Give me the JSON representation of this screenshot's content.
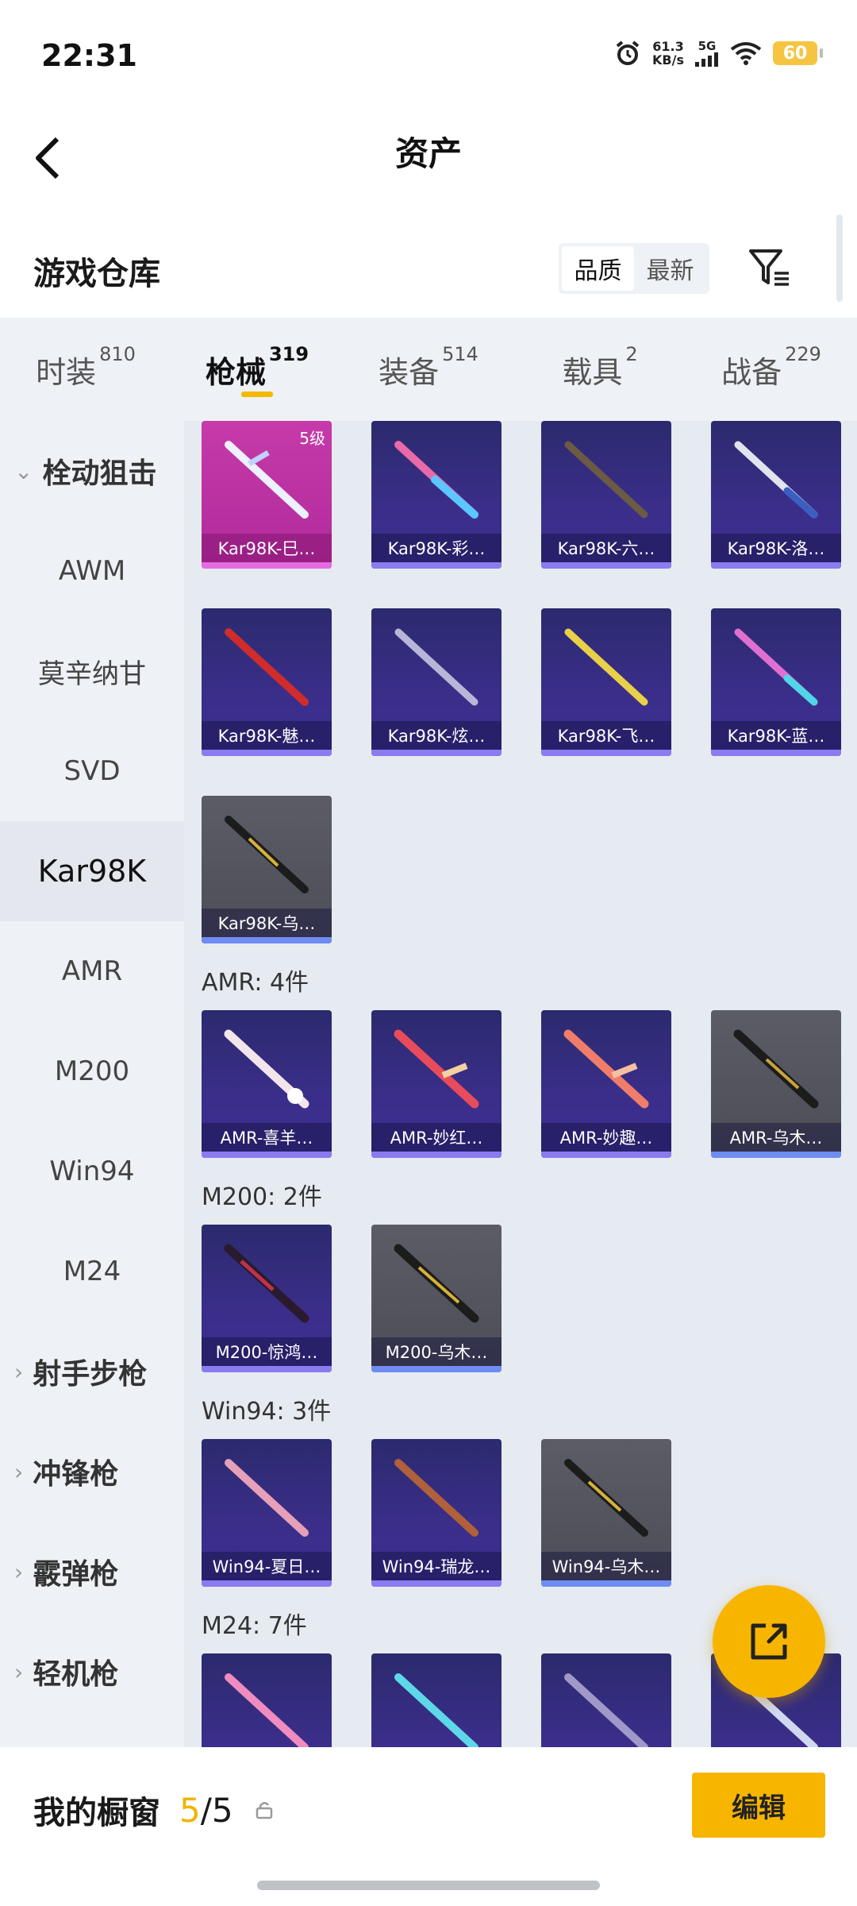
{
  "status_bar": {
    "time": "22:31",
    "net_speed": "61.3",
    "net_unit": "KB/s",
    "network": "5G",
    "battery": "60"
  },
  "header": {
    "title": "资产"
  },
  "warehouse": {
    "title": "游戏仓库",
    "sort_options": [
      "品质",
      "最新"
    ]
  },
  "tabs": [
    {
      "label": "时装",
      "count": "810"
    },
    {
      "label": "枪械",
      "count": "319"
    },
    {
      "label": "装备",
      "count": "514"
    },
    {
      "label": "载具",
      "count": "2"
    },
    {
      "label": "战备",
      "count": "229"
    }
  ],
  "sidebar": {
    "items": [
      "栓动狙击",
      "AWM",
      "莫辛纳甘",
      "SVD",
      "Kar98K",
      "AMR",
      "M200",
      "Win94",
      "M24",
      "射手步枪",
      "冲锋枪",
      "霰弹枪",
      "轻机枪"
    ],
    "active": "Kar98K"
  },
  "content": {
    "kar98k": [
      {
        "label": "Kar98K-巳…",
        "level": "5级"
      },
      {
        "label": "Kar98K-彩…"
      },
      {
        "label": "Kar98K-六…"
      },
      {
        "label": "Kar98K-洛…"
      },
      {
        "label": "Kar98K-魅…"
      },
      {
        "label": "Kar98K-炫…"
      },
      {
        "label": "Kar98K-飞…"
      },
      {
        "label": "Kar98K-蓝…"
      },
      {
        "label": "Kar98K-乌…"
      }
    ],
    "amr_header": "AMR: 4件",
    "amr": [
      {
        "label": "AMR-喜羊…"
      },
      {
        "label": "AMR-妙红…"
      },
      {
        "label": "AMR-妙趣…"
      },
      {
        "label": "AMR-乌木…"
      }
    ],
    "m200_header": "M200: 2件",
    "m200": [
      {
        "label": "M200-惊鸿…"
      },
      {
        "label": "M200-乌木…"
      }
    ],
    "win94_header": "Win94: 3件",
    "win94": [
      {
        "label": "Win94-夏日…"
      },
      {
        "label": "Win94-瑞龙…"
      },
      {
        "label": "Win94-乌木…"
      }
    ],
    "m24_header": "M24: 7件"
  },
  "footer": {
    "showcase_label": "我的橱窗",
    "count_current": "5",
    "count_sep": "/",
    "count_total": "5",
    "edit_label": "编辑"
  }
}
